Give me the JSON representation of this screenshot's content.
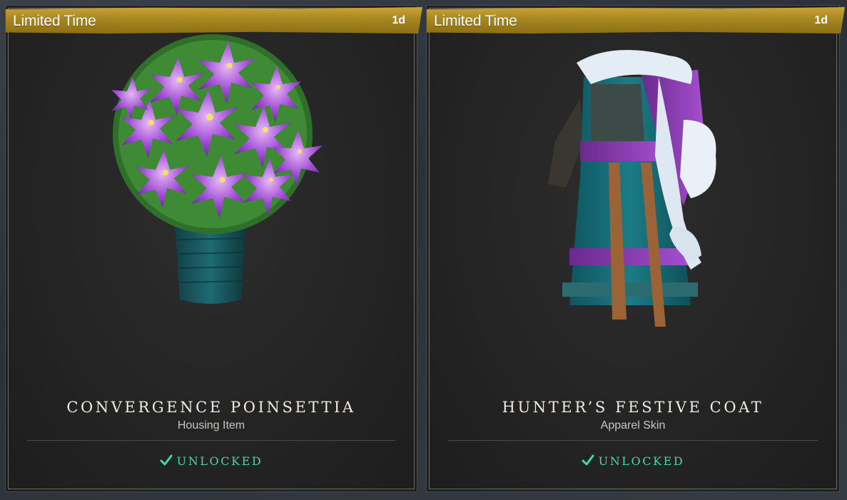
{
  "cards": [
    {
      "banner": {
        "label": "Limited Time",
        "timer": "1d"
      },
      "name": "CONVERGENCE POINSETTIA",
      "type": "Housing Item",
      "status": "UNLOCKED",
      "image": "poinsettia-plant"
    },
    {
      "banner": {
        "label": "Limited Time",
        "timer": "1d"
      },
      "name": "HUNTER’S FESTIVE COAT",
      "type": "Apparel Skin",
      "status": "UNLOCKED",
      "image": "festive-coat"
    }
  ],
  "colors": {
    "banner": "#b8952a",
    "status": "#46d7a2",
    "card_bg": "#262626"
  }
}
